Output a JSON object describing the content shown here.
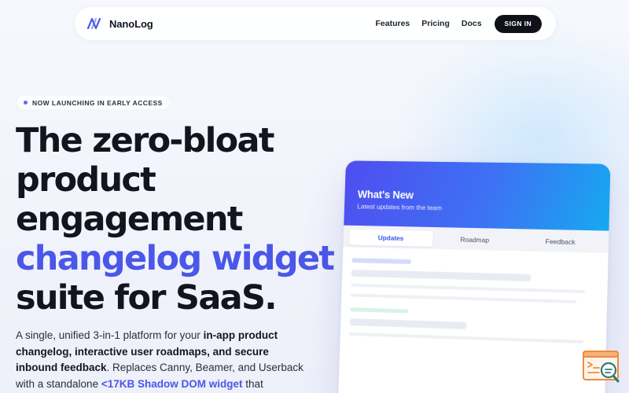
{
  "nav": {
    "brand": "NanoLog",
    "links": [
      "Features",
      "Pricing",
      "Docs"
    ],
    "sign_in": "SIGN IN"
  },
  "hero": {
    "badge": "NOW LAUNCHING IN EARLY ACCESS",
    "title_lines": [
      "The zero-bloat",
      "product",
      "engagement",
      "changelog widget",
      "suite for SaaS."
    ],
    "title_accent_line": "changelog widget",
    "desc": {
      "p1": "A single, unified 3-in-1 platform for your ",
      "b1": "in-app product changelog, interactive user roadmaps, and secure inbound feedback",
      "p2": ". Replaces Canny, Beamer, and Userback with a standalone ",
      "hl": "<17KB Shadow DOM widget",
      "p3": " that preserves your"
    }
  },
  "widget": {
    "title": "What's New",
    "subtitle": "Latest updates from the team",
    "tabs": [
      "Updates",
      "Roadmap",
      "Feedback"
    ],
    "active_tab": "Updates"
  },
  "icons": {
    "brand": "nanolog-logo-icon",
    "badge_dot": "status-dot-icon",
    "corner": "support-chat-icon"
  },
  "colors": {
    "accent": "#4a57e8",
    "dark": "#111219",
    "header_gradient": [
      "#4f4df0",
      "#3d72f4",
      "#16a9ef"
    ],
    "corner_icon": "#f08a3a"
  }
}
